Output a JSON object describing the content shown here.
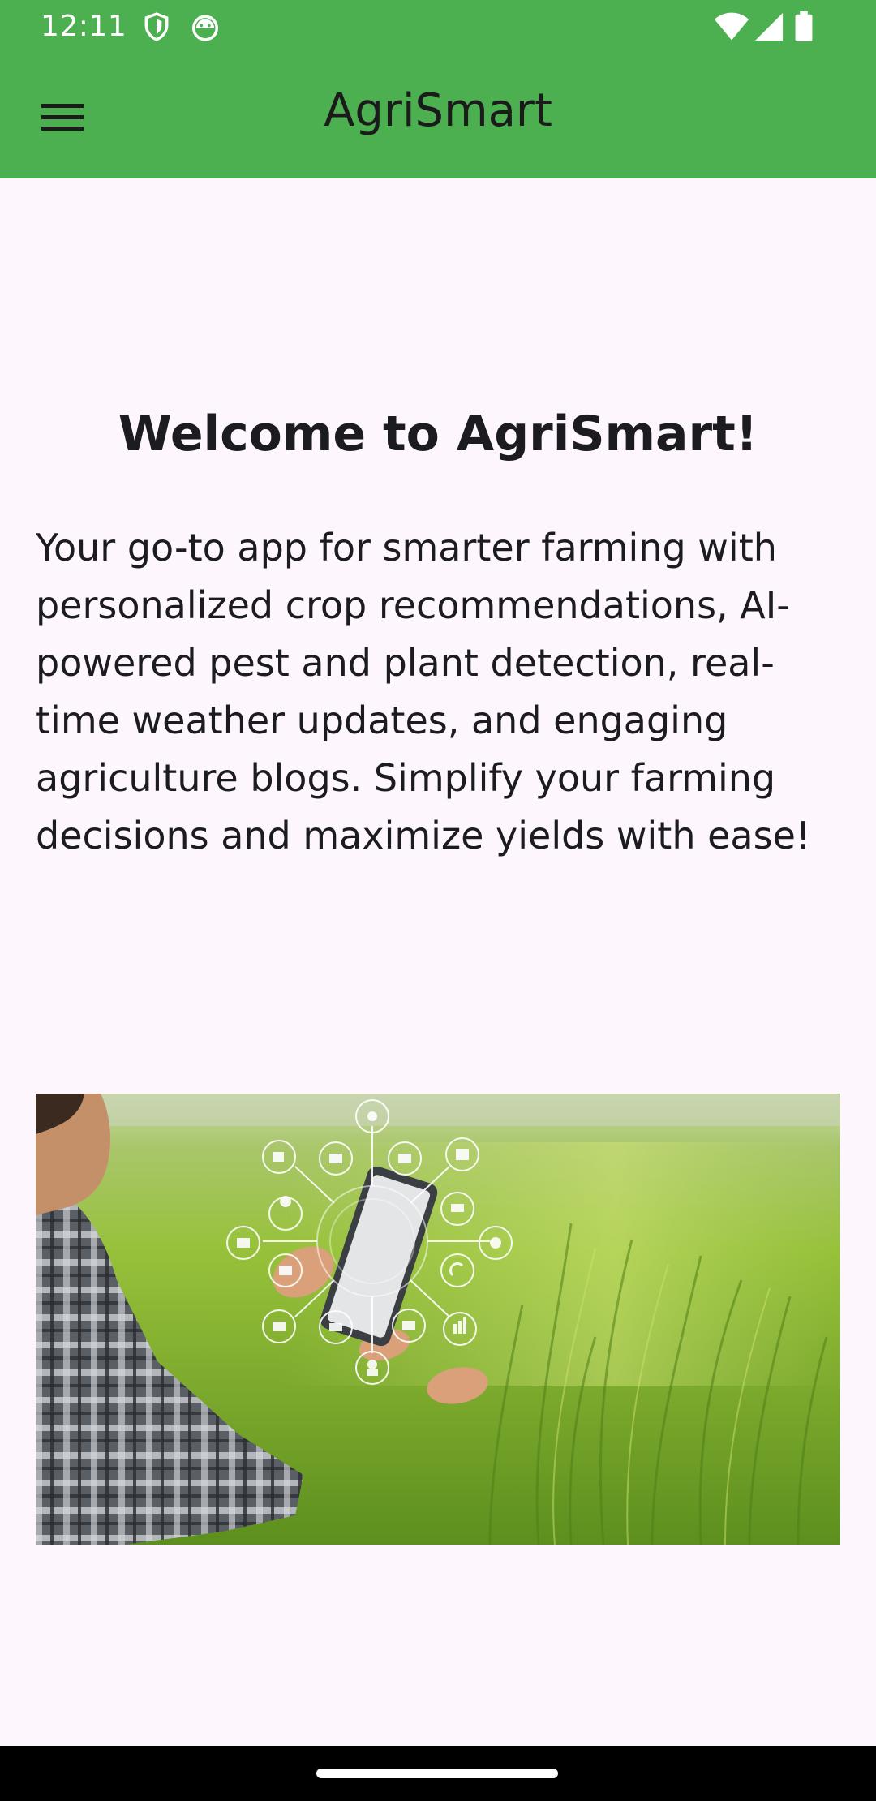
{
  "status_bar": {
    "time": "12:11",
    "left_icons": [
      "shield-icon",
      "android-icon"
    ],
    "right_icons": [
      "wifi-icon",
      "signal-icon",
      "battery-icon"
    ]
  },
  "app_bar": {
    "title": "AgriSmart",
    "menu_icon": "hamburger-menu-icon",
    "background_color": "#4caf50"
  },
  "main": {
    "headline": "Welcome to AgriSmart!",
    "description": "Your go-to app for smarter farming with personalized crop recommendations, AI-powered pest and plant detection, real-time weather updates, and engaging agriculture blogs. Simplify your farming decisions and maximize yields with ease!"
  },
  "colors": {
    "primary": "#4caf50",
    "background": "#fdf7fd",
    "text": "#1c1b1f"
  }
}
